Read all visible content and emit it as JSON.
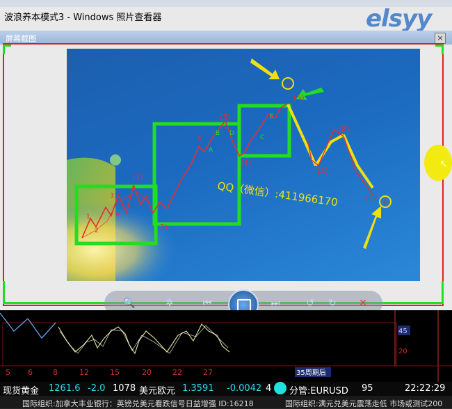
{
  "window": {
    "title": "波浪养本模式3 - Windows 照片查看器",
    "watermark": "elsyy"
  },
  "capture": {
    "title": "屏幕截图",
    "close": "×"
  },
  "chart_labels": {
    "w1": "(1)",
    "w2": "2)",
    "w3": "(3)",
    "w4": "(4)",
    "w5": "(5)",
    "wa": "(A)",
    "wb": "(B)",
    "wc": "(C)",
    "small_1": "1",
    "small_2": "2",
    "small_3": "3",
    "small_4": "4",
    "small_5": "5",
    "small_a": "A",
    "small_b": "B",
    "small_c": "C",
    "small_d": "D",
    "small_e": "E",
    "circle_top": "1",
    "circle_bottom": "4"
  },
  "qq_text": "QQ（微信）:411966170",
  "controls": {
    "search": "🔍",
    "settings": "✲",
    "prev": "⏮",
    "next": "⏭",
    "rotate_ccw": "↺",
    "rotate_cw": "↻",
    "delete": "✕"
  },
  "terminal": {
    "scale_45": "45",
    "scale_20": "20",
    "x_ticks": [
      "5",
      "6",
      "8",
      "12",
      "15",
      "20",
      "22",
      "27"
    ],
    "period_label": "35周期后",
    "ticker": {
      "gold_label": "现货黄金",
      "gold_price": "1261.6",
      "gold_change": "-2.0",
      "gold_vol": "1078",
      "eur_label": "美元欧元",
      "eur_price": "1.3591",
      "eur_change": "-0.0042",
      "eur_extra": "4",
      "mgmt_label": "分管:EURUSD",
      "mgmt_value": "95",
      "clock": "22:22:29"
    },
    "news": [
      "国际组织:加拿大丰业银行：英镑兑美元看跌信号日益增强 ID:16218",
      "国际组织:满元兑美元震荡走低 市场或测试200"
    ]
  },
  "colors": {
    "frame_red": "#e02020",
    "box_green": "#22dd22",
    "wave_red": "#e03030",
    "arrow_yellow": "#f0e010"
  }
}
